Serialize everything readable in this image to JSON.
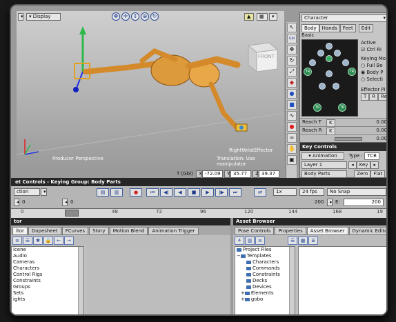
{
  "viewport": {
    "display_label": "Display",
    "front_cube_label": "FRONT",
    "camera_label": "Producer Perspective",
    "effector_label": "RightWristEffector",
    "translation_label": "Translation: Use manipulator",
    "coords": {
      "t_label": "T (Gbl)",
      "x": "-72.09",
      "y": "35.77",
      "z": "39.37"
    }
  },
  "character_panel": {
    "dropdown_value": "Character",
    "tabs": [
      "Body",
      "Hands",
      "Feet",
      "Edit"
    ],
    "basic_label": "Basic",
    "active_label": "Active",
    "ctrl_label": "Ctrl Ri",
    "keying_mode_label": "Keying Mo",
    "keying_options": [
      "Full Bo",
      "Body P",
      "Selecti"
    ],
    "effector_pivot_label": "Effector Pi",
    "pivot_buttons": [
      "T",
      "R",
      "Re"
    ],
    "reach_rows": [
      {
        "label": "Reach T",
        "key": "K",
        "value": "0.00"
      },
      {
        "label": "Reach R",
        "key": "K",
        "value": "0.00"
      },
      {
        "label": "",
        "key": "",
        "value": "0.00"
      }
    ],
    "tr_badge": "TR"
  },
  "key_controls": {
    "title": "Key Controls",
    "animation_label": "Animation",
    "type_label": "Type :",
    "type_value": "TCB",
    "layer_value": "Layer 1",
    "key_btn": "Key",
    "body_parts_value": "Body Parts",
    "zero_btn": "Zero",
    "flat_btn": "Flat"
  },
  "transport": {
    "title": "et Controls  -  Keying Group: Body Parts",
    "action_value": "ction",
    "speed_value": "1x",
    "fps_value": "24 fps",
    "snap_value": "No Snap",
    "start_frame": "0",
    "start_frame2": "0",
    "end_frame": "200",
    "end_label": "E:",
    "end_value": "200",
    "ruler_ticks": [
      "0",
      "48",
      "72",
      "96",
      "120",
      "144",
      "168",
      "19"
    ]
  },
  "story_panel": {
    "title": "tor",
    "tabs": [
      "itor",
      "Dopesheet",
      "FCurves",
      "Story",
      "Motion Blend",
      "Animation Trigger"
    ],
    "items": [
      "icene",
      "Audio",
      "Cameras",
      "Characters",
      "Control Rigs",
      "Constraints",
      "Groups",
      "Sets",
      "ights"
    ]
  },
  "asset_browser": {
    "title": "Asset Browser",
    "tabs": [
      "Pose Controls",
      "Properties",
      "Asset Browser",
      "Dynamic Editor"
    ],
    "tree": [
      {
        "label": "Project Files",
        "indent": 0
      },
      {
        "label": "Templates",
        "indent": 0
      },
      {
        "label": "Characters",
        "indent": 2
      },
      {
        "label": "Commands",
        "indent": 2
      },
      {
        "label": "Constraints",
        "indent": 2
      },
      {
        "label": "Decks",
        "indent": 2
      },
      {
        "label": "Devices",
        "indent": 2
      },
      {
        "label": "Elements",
        "indent": 1
      },
      {
        "label": "gobo",
        "indent": 1
      }
    ]
  }
}
